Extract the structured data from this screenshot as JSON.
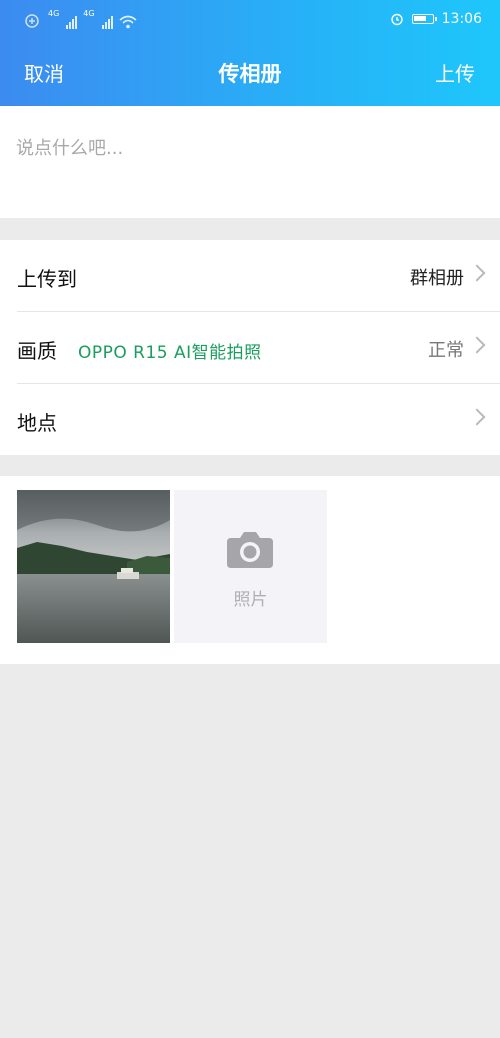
{
  "status_bar": {
    "network_left": "4G",
    "network_right": "4G",
    "time": "13:06",
    "battery_level": 0.75,
    "icons": [
      "hd-call-icon",
      "signal-icon",
      "signal-icon",
      "wifi-icon",
      "alarm-icon",
      "battery-icon"
    ]
  },
  "header": {
    "cancel_label": "取消",
    "title": "传相册",
    "upload_label": "上传",
    "gradient_colors": [
      "#3c8bf0",
      "#1ec7fb"
    ]
  },
  "caption": {
    "placeholder": "说点什么吧..."
  },
  "settings": {
    "upload_to": {
      "label": "上传到",
      "value": "群相册"
    },
    "quality": {
      "label": "画质",
      "badge": "OPPO R15  AI智能拍照",
      "value": "正常",
      "badge_color": "#1a9e5f"
    },
    "location": {
      "label": "地点",
      "value": ""
    }
  },
  "photos": {
    "add_label": "照片",
    "thumbnails": [
      {
        "name": "lake-landscape-photo"
      }
    ]
  }
}
